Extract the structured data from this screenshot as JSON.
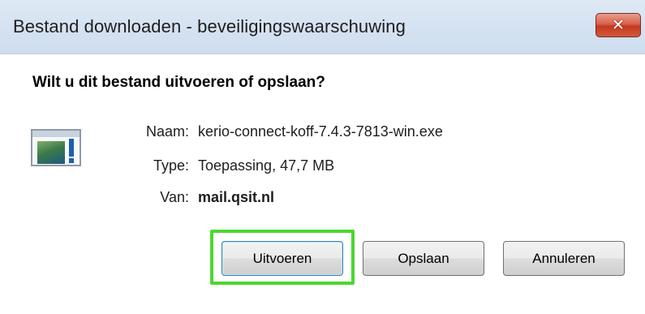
{
  "window": {
    "title": "Bestand downloaden - beveiligingswaarschuwing",
    "close_glyph": "✕"
  },
  "question": "Wilt u dit bestand uitvoeren of opslaan?",
  "file": {
    "icon": "application-exe-icon",
    "name_label": "Naam:",
    "name_value": "kerio-connect-koff-7.4.3-7813-win.exe",
    "type_label": "Type:",
    "type_value": "Toepassing, 47,7 MB",
    "from_label": "Van:",
    "from_value": "mail.qsit.nl"
  },
  "buttons": {
    "run": "Uitvoeren",
    "save": "Opslaan",
    "cancel": "Annuleren"
  },
  "colors": {
    "highlight": "#4cd82e",
    "close_button": "#c3391f",
    "titlebar": "#d3e1f1"
  }
}
